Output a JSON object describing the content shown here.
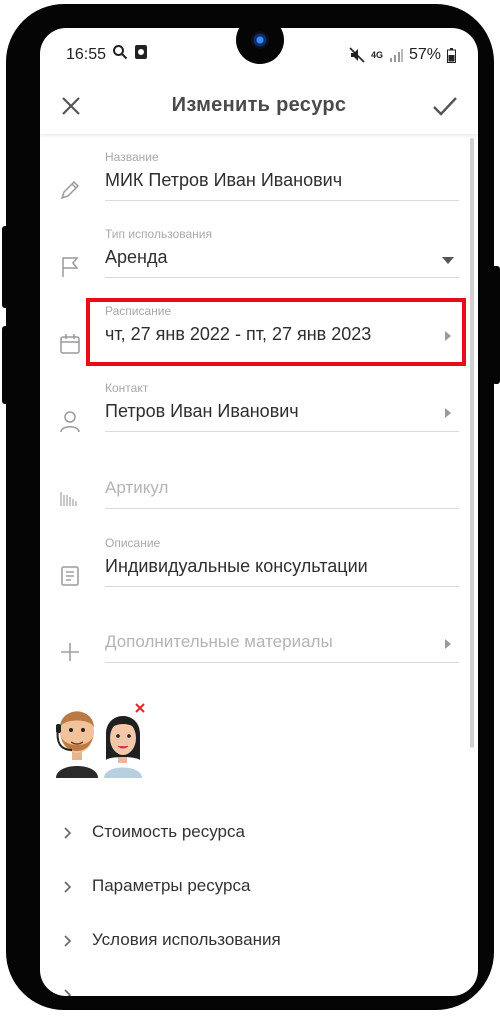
{
  "status_bar": {
    "time": "16:55",
    "battery": "57%",
    "network": "4G",
    "icons": [
      "search-icon",
      "app-icon",
      "mute-icon",
      "network-4g-icon",
      "signal-icon",
      "battery-icon"
    ]
  },
  "appbar": {
    "title": "Изменить ресурс",
    "close_icon": "close-icon",
    "save_icon": "check-icon"
  },
  "form": {
    "name": {
      "label": "Название",
      "value": "МИК Петров Иван Иванович",
      "icon": "pencil-icon"
    },
    "usage_type": {
      "label": "Тип использования",
      "value": "Аренда",
      "icon": "flag-icon"
    },
    "schedule": {
      "label": "Расписание",
      "value": "чт, 27 янв 2022 - пт, 27 янв 2023",
      "icon": "calendar-icon"
    },
    "contact": {
      "label": "Контакт",
      "value": "Петров Иван Иванович",
      "icon": "person-icon"
    },
    "sku": {
      "placeholder": "Артикул",
      "icon": "barcode-icon"
    },
    "description": {
      "label": "Описание",
      "value": "Индивидуальные консультации",
      "icon": "document-icon"
    },
    "extras": {
      "placeholder": "Дополнительные материалы",
      "icon": "plus-icon"
    }
  },
  "sections": [
    {
      "label": "Стоимость ресурса"
    },
    {
      "label": "Параметры ресурса"
    },
    {
      "label": "Условия использования"
    }
  ],
  "colors": {
    "highlight": "#ea0b19",
    "label": "#a8a8a8",
    "text": "#2e2e2e"
  }
}
